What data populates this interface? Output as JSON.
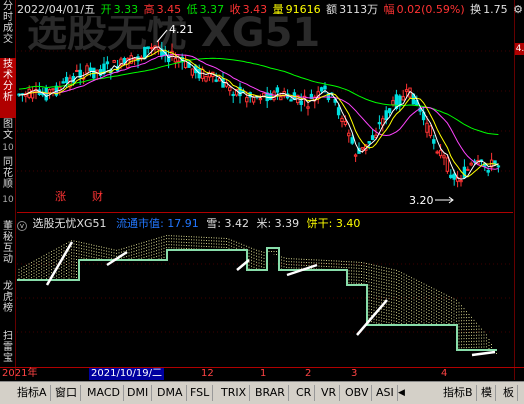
{
  "sidebar": {
    "tabs": [
      {
        "label": "分时成交",
        "active": false
      },
      {
        "label": "技术分析",
        "active": true
      },
      {
        "label": "图文",
        "active": false
      },
      {
        "label": "同花顺",
        "active": false
      },
      {
        "label": "董秘互动",
        "active": false
      },
      {
        "label": "龙虎榜",
        "active": false
      },
      {
        "label": "扫雷宝",
        "active": false
      }
    ],
    "sub_labels": [
      "10",
      "10"
    ]
  },
  "right_strip": {
    "marker": "4."
  },
  "quote": {
    "date": "2022/04/01/五",
    "open_label": "开",
    "open": "3.33",
    "high_label": "高",
    "high": "3.45",
    "low_label": "低",
    "low": "3.37",
    "close_label": "收",
    "close": "3.43",
    "volume_label": "量",
    "volume": "91616",
    "amount_label": "额",
    "amount": "3113万",
    "change_label": "幅",
    "change": "0.02(0.59%)",
    "turnover_label": "换",
    "turnover": "1.75"
  },
  "main_chart": {
    "watermark": "选股无忧 XG51",
    "high_annotation": "4.21",
    "low_annotation": "3.20",
    "tags": [
      "涨",
      "财"
    ]
  },
  "indicator": {
    "name": "选股无忧XG51",
    "line1_label": "流通市值",
    "line1_value": "17.91",
    "line2_label": "雪",
    "line2_value": "3.42",
    "line3_label": "米",
    "line3_value": "3.39",
    "line4_label": "饼干",
    "line4_value": "3.40",
    "colors": {
      "line1": "#2277ff",
      "line2": "#ffffff",
      "line3": "#ffffff",
      "line4": "#ffff44"
    }
  },
  "time_axis": {
    "year": "2021年",
    "cursor_date": "2021/10/19/二",
    "ticks": [
      "12",
      "1",
      "2",
      "3",
      "4"
    ]
  },
  "tabbar": {
    "left_tabs": [
      "指标A",
      "窗口",
      "MACD",
      "DMI",
      "DMA",
      "FSL",
      "TRIX",
      "BRAR",
      "CR",
      "VR",
      "OBV",
      "ASI"
    ],
    "right_tabs": [
      "指标B",
      "模",
      "板"
    ],
    "nav_prev": "◀",
    "nav_next": "▶"
  },
  "colors": {
    "up": "#ff3333",
    "down": "#00e000",
    "ma5": "#ffffff",
    "ma10": "#ffff00",
    "ma20": "#ff44ff",
    "ma60": "#00ff00",
    "indicator_fill": "#ffffaa",
    "indicator_line": "#88ddaa"
  }
}
